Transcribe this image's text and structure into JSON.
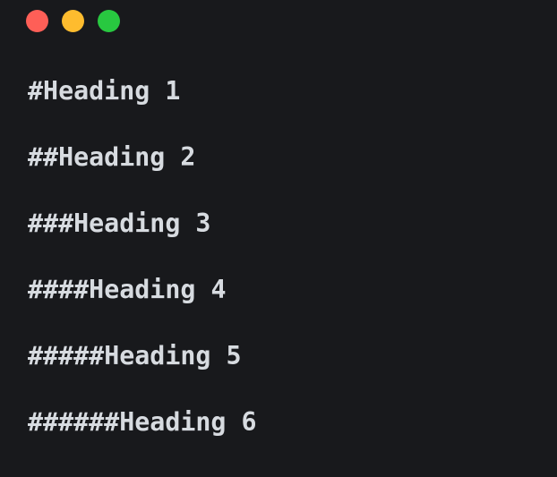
{
  "window": {
    "controls": [
      {
        "name": "close",
        "color": "#fe5f57"
      },
      {
        "name": "minimize",
        "color": "#febc2e"
      },
      {
        "name": "maximize",
        "color": "#28c840"
      }
    ]
  },
  "editor": {
    "lines": [
      {
        "marker": "#",
        "text": "Heading 1"
      },
      {
        "marker": "##",
        "text": "Heading 2"
      },
      {
        "marker": "###",
        "text": "Heading 3"
      },
      {
        "marker": "####",
        "text": "Heading 4"
      },
      {
        "marker": "#####",
        "text": "Heading 5"
      },
      {
        "marker": "######",
        "text": "Heading 6"
      }
    ]
  }
}
